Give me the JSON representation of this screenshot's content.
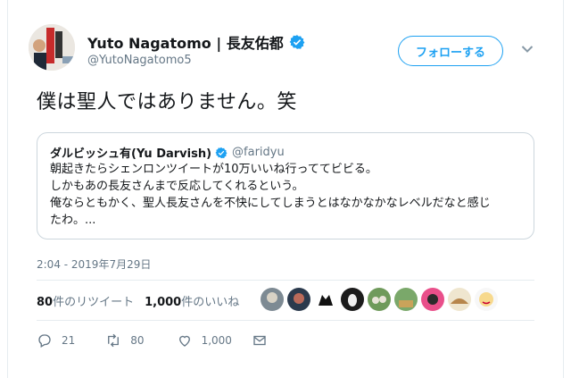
{
  "tweet": {
    "display_name": "Yuto Nagatomo | 長友佑都",
    "handle": "@YutoNagatomo5",
    "follow_label": "フォローする",
    "text": "僕は聖人ではありません。笑",
    "timestamp": "2:04 - 2019年7月29日"
  },
  "quote": {
    "display_name": "ダルビッシュ有(Yu Darvish)",
    "handle": "@faridyu",
    "lines": [
      "朝起きたらシェンロンツイートが10万いいね行っててビビる。",
      "しかもあの長友さんまで反応してくれるという。",
      "俺ならともかく、聖人長友さんを不快にしてしまうとはなかなかなレベルだなと感じ",
      "たわ。..."
    ]
  },
  "stats": {
    "retweets_count": "80",
    "retweets_label": "件のリツイート",
    "likes_count": "1,000",
    "likes_label": "件のいいね"
  },
  "actions": {
    "reply_count": "21",
    "retweet_count": "80",
    "like_count": "1,000"
  },
  "icons": {
    "verified": "verified-badge-icon",
    "chevron": "chevron-down-icon",
    "reply": "reply-icon",
    "retweet": "retweet-icon",
    "like": "heart-icon",
    "dm": "envelope-icon"
  },
  "colors": {
    "accent": "#1da1f2",
    "secondary_text": "#657786",
    "border": "#e6ecf0"
  }
}
